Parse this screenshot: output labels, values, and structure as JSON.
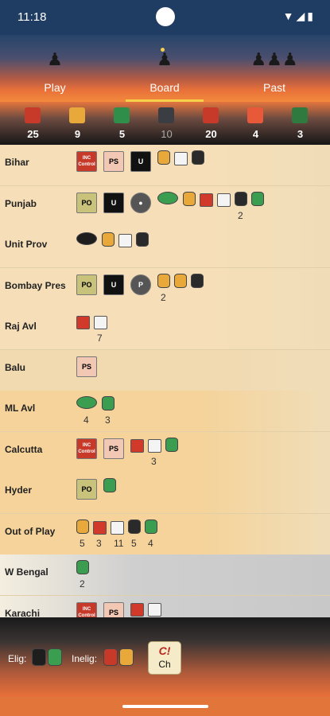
{
  "status": {
    "time": "11:18",
    "icons": "▼◢▮"
  },
  "tabs": [
    {
      "label": "Play",
      "icon": "silhouette-icon"
    },
    {
      "label": "Board",
      "icon": "figure-icon"
    },
    {
      "label": "Past",
      "icon": "group-icon"
    }
  ],
  "counts": [
    {
      "value": "25",
      "color": "#c73a2a",
      "icon": "red-badge-icon"
    },
    {
      "value": "9",
      "color": "#e8a93a",
      "icon": "gold-badge-icon"
    },
    {
      "value": "5",
      "color": "#2f8f4a",
      "icon": "green-badge-icon"
    },
    {
      "value": "10",
      "color": "#3a3d41",
      "icon": "black-star-icon"
    },
    {
      "value": "20",
      "color": "#c73a2a",
      "icon": "red-crown-icon"
    },
    {
      "value": "4",
      "color": "#e8593a",
      "icon": "red-flag-icon"
    },
    {
      "value": "3",
      "color": "#2f7a3f",
      "icon": "green-flag-icon"
    }
  ],
  "rows": [
    {
      "name": "Bihar",
      "bg": "#f6dfb8"
    },
    {
      "name": "Punjab",
      "bg": "#f6dfb8"
    },
    {
      "name": "Unit Prov",
      "bg": "#f6dfb8"
    },
    {
      "name": "Bombay Pres",
      "bg": "#f6dfb8"
    },
    {
      "name": "Raj Avl",
      "bg": "#f6dfb8"
    },
    {
      "name": "Balu",
      "bg": "#f1d9b0"
    },
    {
      "name": "ML Avl",
      "bg": "#f5d39a"
    },
    {
      "name": "Calcutta",
      "bg": "#f5d39a"
    },
    {
      "name": "Hyder",
      "bg": "#f5d39a"
    },
    {
      "name": "Out of Play",
      "bg": "#f5d39a"
    },
    {
      "name": "W Bengal",
      "bg": "#cfcfcf"
    },
    {
      "name": "Karachi",
      "bg": "#cfcfcf"
    }
  ],
  "pieces": {
    "bihar": [
      {
        "kind": "tile",
        "label": "INC Control",
        "color": "#c73a2a"
      },
      {
        "kind": "tile",
        "label": "PS",
        "color": "#f2c7b3"
      },
      {
        "kind": "tile",
        "label": "U",
        "color": "#111111"
      },
      {
        "kind": "cyl",
        "color": "#e8a93a"
      },
      {
        "kind": "cube",
        "color": "#f4f4f4"
      },
      {
        "kind": "cyl",
        "color": "#2a2a2a"
      }
    ],
    "punjab": [
      {
        "kind": "tile",
        "label": "PO",
        "color": "#c9c27a"
      },
      {
        "kind": "tile",
        "label": "U",
        "color": "#111111"
      },
      {
        "kind": "tile",
        "label": "●",
        "color": "#555555"
      },
      {
        "kind": "disc",
        "color": "#3a9d4f"
      },
      {
        "kind": "cyl",
        "color": "#e8a93a"
      },
      {
        "kind": "cube",
        "color": "#d13a2a"
      },
      {
        "kind": "cube",
        "color": "#f4f4f4"
      },
      {
        "kind": "cyl",
        "color": "#2a2a2a",
        "count": "2"
      },
      {
        "kind": "cyl",
        "color": "#3a9d4f"
      }
    ],
    "unitprov": [
      {
        "kind": "disc",
        "color": "#1e1e1e"
      },
      {
        "kind": "cyl",
        "color": "#e8a93a"
      },
      {
        "kind": "cube",
        "color": "#f4f4f4"
      },
      {
        "kind": "cyl",
        "color": "#2a2a2a"
      }
    ],
    "bombay": [
      {
        "kind": "tile",
        "label": "PO",
        "color": "#c9c27a"
      },
      {
        "kind": "tile",
        "label": "U",
        "color": "#111111"
      },
      {
        "kind": "tile",
        "label": "P",
        "color": "#555555"
      },
      {
        "kind": "cyl",
        "color": "#e8a93a",
        "count": "2"
      },
      {
        "kind": "cyl",
        "color": "#e8a93a"
      },
      {
        "kind": "cyl",
        "color": "#2a2a2a"
      }
    ],
    "raj": [
      {
        "kind": "cube",
        "color": "#d13a2a"
      },
      {
        "kind": "cube",
        "color": "#f4f4f4",
        "count": "7"
      }
    ],
    "balu": [
      {
        "kind": "tile",
        "label": "PS",
        "color": "#f2c7b3"
      }
    ],
    "mlavl": [
      {
        "kind": "disc",
        "color": "#3a9d4f",
        "count": "4"
      },
      {
        "kind": "cyl",
        "color": "#3a9d4f",
        "count": "3"
      }
    ],
    "calcutta": [
      {
        "kind": "tile",
        "label": "INC Control",
        "color": "#c73a2a"
      },
      {
        "kind": "tile",
        "label": "PS",
        "color": "#f2c7b3"
      },
      {
        "kind": "cube",
        "color": "#d13a2a"
      },
      {
        "kind": "cube",
        "color": "#f4f4f4",
        "count": "3"
      },
      {
        "kind": "cyl",
        "color": "#3a9d4f"
      }
    ],
    "hyder": [
      {
        "kind": "tile",
        "label": "PO",
        "color": "#c9c27a"
      },
      {
        "kind": "cyl",
        "color": "#3a9d4f"
      }
    ],
    "outofplay": [
      {
        "kind": "cyl",
        "color": "#e8a93a",
        "count": "5"
      },
      {
        "kind": "cube",
        "color": "#d13a2a",
        "count": "3"
      },
      {
        "kind": "cube",
        "color": "#f4f4f4",
        "count": "11"
      },
      {
        "kind": "cyl",
        "color": "#2a2a2a",
        "count": "5"
      },
      {
        "kind": "cyl",
        "color": "#3a9d4f",
        "count": "4"
      }
    ],
    "wbengal": [
      {
        "kind": "cyl",
        "color": "#3a9d4f",
        "count": "2"
      }
    ],
    "karachi": [
      {
        "kind": "tile",
        "label": "INC Control",
        "color": "#c73a2a"
      },
      {
        "kind": "tile",
        "label": "PS",
        "color": "#f2c7b3"
      },
      {
        "kind": "cube",
        "color": "#d13a2a"
      },
      {
        "kind": "cube",
        "color": "#f4f4f4"
      }
    ]
  },
  "footer": {
    "elig_label": "Elig:",
    "inelig_label": "Inelig:",
    "button_line1": "C!",
    "button_line2": "Ch"
  }
}
